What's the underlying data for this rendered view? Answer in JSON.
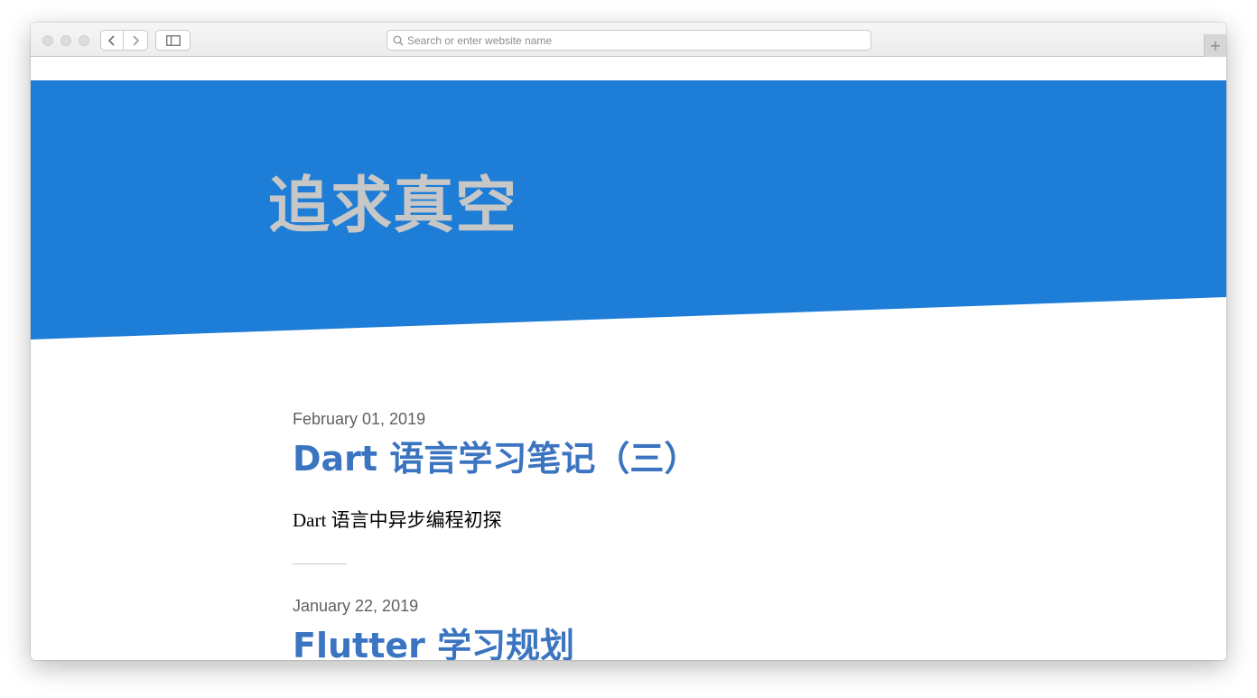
{
  "browser": {
    "address_placeholder": "Search or enter website name",
    "address_value": "",
    "new_tab_label": "+"
  },
  "site": {
    "title": "追求真空",
    "hero_color": "#1e7dd6",
    "title_color": "#c7c7c7",
    "link_color": "#3b74c0"
  },
  "posts": [
    {
      "date": "February 01, 2019",
      "title": "Dart 语言学习笔记（三）",
      "summary": "Dart 语言中异步编程初探"
    },
    {
      "date": "January 22, 2019",
      "title": "Flutter 学习规划"
    }
  ]
}
